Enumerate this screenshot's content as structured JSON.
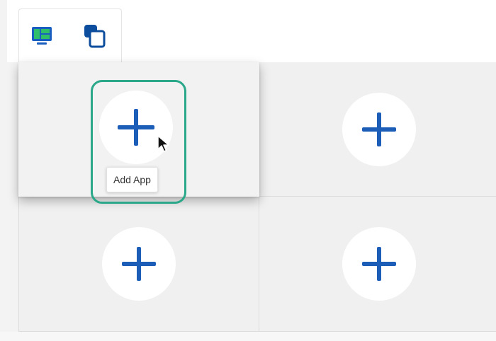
{
  "toolbar": {
    "layout_icon": "layout-grid-monitor-icon",
    "windows_icon": "cascade-windows-icon",
    "accent_color": "#1f6fce",
    "secondary_color": "#0d4d9e"
  },
  "grid": {
    "cells": [
      {
        "icon": "plus-icon",
        "state": "hovered"
      },
      {
        "icon": "plus-icon",
        "state": "default"
      },
      {
        "icon": "plus-icon",
        "state": "default"
      },
      {
        "icon": "plus-icon",
        "state": "default"
      }
    ],
    "highlight_color": "#2aa889"
  },
  "tooltip": {
    "text": "Add App"
  }
}
